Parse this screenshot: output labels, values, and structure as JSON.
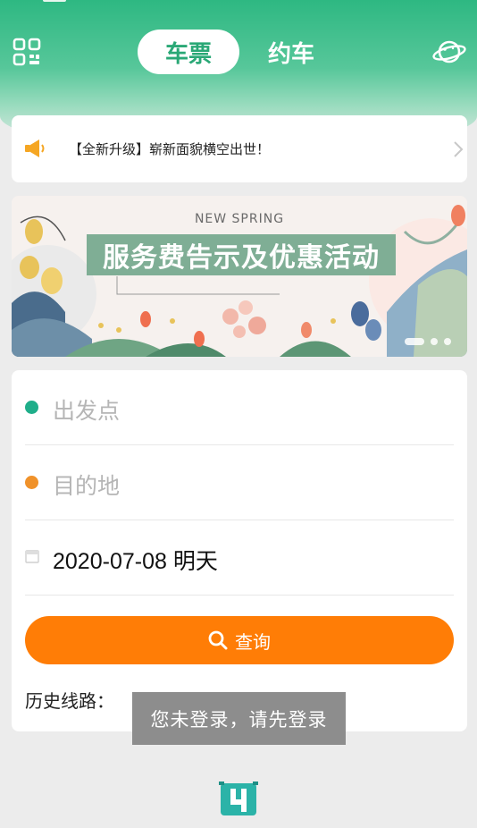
{
  "header": {
    "tabs": [
      {
        "label": "车票",
        "active": true
      },
      {
        "label": "约车",
        "active": false
      }
    ],
    "accent_color": "#2eb882"
  },
  "notice": {
    "text": "【全新升级】崭新面貌横空出世！"
  },
  "banner": {
    "subtitle": "NEW SPRING",
    "title": "服务费告示及优惠活动",
    "slide_count": 3,
    "active_slide": 1
  },
  "form": {
    "departure_placeholder": "出发点",
    "destination_placeholder": "目的地",
    "date_value": "2020-07-08 明天",
    "query_label": "查询",
    "history_label": "历史线路：",
    "departure_color": "#1fae8a",
    "destination_color": "#f0922a",
    "button_color": "#ff7d06"
  },
  "toast": {
    "text": "您未登录，请先登录"
  },
  "icons": [
    "qr-code-icon",
    "planet-icon",
    "megaphone-icon",
    "chevron-right-icon",
    "calendar-icon",
    "search-icon",
    "app-logo-icon"
  ]
}
